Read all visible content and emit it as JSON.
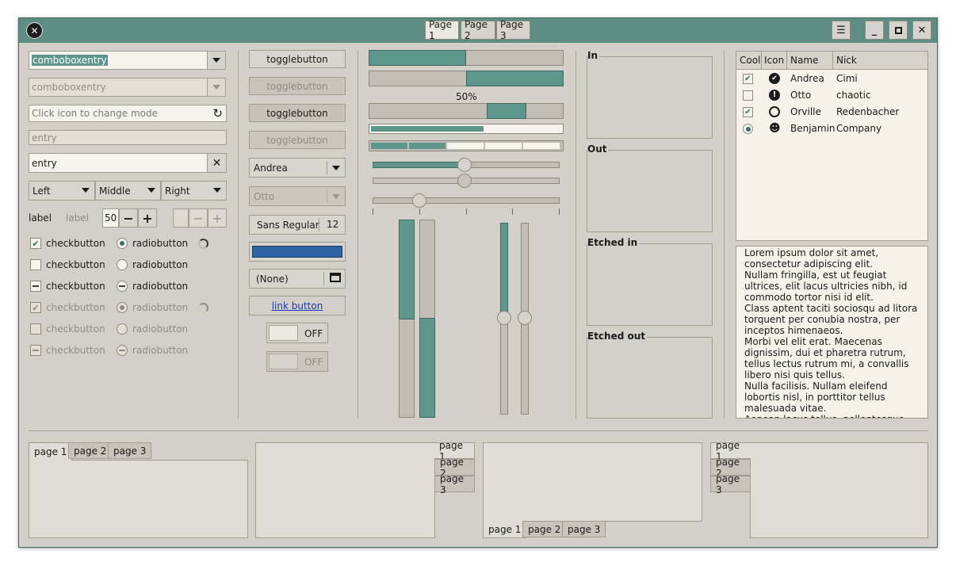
{
  "window": {
    "pages": [
      "Page 1",
      "Page 2",
      "Page 3"
    ]
  },
  "left": {
    "combo1_value": "comboboxentry",
    "combo2_value": "comboboxentry",
    "icon_entry_placeholder": "Click icon to change mode",
    "entry_disabled": "entry",
    "entry_value": "entry",
    "align_buttons": [
      "Left",
      "Middle",
      "Right"
    ],
    "label1": "label",
    "label2": "label",
    "spin_value": "50",
    "checkbuttons": [
      "checkbutton",
      "checkbutton",
      "checkbutton",
      "checkbutton",
      "checkbutton",
      "checkbutton"
    ],
    "radiobuttons": [
      "radiobutton",
      "radiobutton",
      "radiobutton",
      "radiobutton",
      "radiobutton",
      "radiobutton"
    ]
  },
  "middle": {
    "togglebuttons": [
      "togglebutton",
      "togglebutton",
      "togglebutton",
      "togglebutton"
    ],
    "combo_andrea": "Andrea",
    "combo_otto": "Otto",
    "font_name": "Sans Regular",
    "font_size": "12",
    "color_hex": "#2e62a3",
    "file_none": "(None)",
    "link": "link button",
    "switch1": "OFF",
    "switch2": "OFF"
  },
  "progress": {
    "bar1": 0.5,
    "bar2": 0.5,
    "percent_text": "50%",
    "scale_value": 0.5,
    "scale_marks": 5
  },
  "frames": [
    "In",
    "Out",
    "Etched in",
    "Etched out"
  ],
  "tree": {
    "headers": [
      "Cool",
      "Icon",
      "Name",
      "Nick"
    ],
    "rows": [
      {
        "name": "Andrea",
        "nick": "Cimi",
        "cool": "check",
        "icon": "face-icon"
      },
      {
        "name": "Otto",
        "nick": "chaotic",
        "cool": "none",
        "icon": "warning-icon"
      },
      {
        "name": "Orville",
        "nick": "Redenbacher",
        "cool": "check",
        "icon": "clock-icon"
      },
      {
        "name": "Benjamin",
        "nick": "Company",
        "cool": "radio",
        "icon": "person-icon"
      }
    ]
  },
  "text_view": "Lorem ipsum dolor sit amet, consectetur adipiscing elit.\nNullam fringilla, est ut feugiat ultrices, elit lacus ultricies nibh, id commodo tortor nisi id elit.\nClass aptent taciti sociosqu ad litora torquent per conubia nostra, per inceptos himenaeos.\nMorbi vel elit erat. Maecenas dignissim, dui et pharetra rutrum, tellus lectus rutrum mi, a convallis libero nisi quis tellus.\nNulla facilisis. Nullam eleifend lobortis nisl, in porttitor tellus malesuada vitae.\nAenean lacus tellus, pellentesque quis molestie quis, fringilla in arcu.",
  "notebooks": {
    "tabs": [
      "page 1",
      "page 2",
      "page 3"
    ]
  },
  "colors": {
    "accent": "#5e968b",
    "header": "#5e8d84"
  }
}
